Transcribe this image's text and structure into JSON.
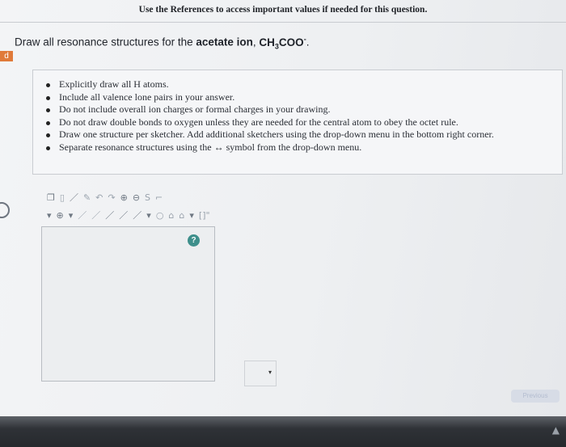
{
  "header": {
    "note": "Use the References to access important values if needed for this question."
  },
  "question": {
    "prefix": "Draw all resonance structures for the ",
    "subject": "acetate ion",
    "formula_a": "CH",
    "formula_sub": "3",
    "formula_b": "COO",
    "formula_sup": "-",
    "suffix": "."
  },
  "side_tab_label": "d",
  "instructions": [
    "Explicitly draw all H atoms.",
    "Include all valence lone pairs in your answer.",
    "Do not include overall ion charges or formal charges in your drawing.",
    "Do not draw double bonds to oxygen unless they are needed for the central atom to obey the octet rule.",
    "Draw one structure per sketcher. Add additional sketchers using the drop-down menu in the bottom right corner.",
    "Separate resonance structures using the ↔ symbol from the drop-down menu."
  ],
  "toolbar_row1": [
    "❐",
    "▯",
    "／",
    "✎",
    "↶",
    "↷",
    "⊕",
    "⊖",
    "S",
    "⌐"
  ],
  "toolbar_row2": [
    "▾",
    "⊕",
    "▾",
    "／",
    "／",
    "／",
    "／",
    "／",
    "▾",
    "○",
    "⌂",
    "⌂",
    "▾",
    "[]\""
  ],
  "help_symbol": "?",
  "dropdown": {
    "arrow": "▾"
  },
  "previous_label": "Previous",
  "icons": {
    "help": "help-icon",
    "taskbar": "arrow-icon"
  }
}
